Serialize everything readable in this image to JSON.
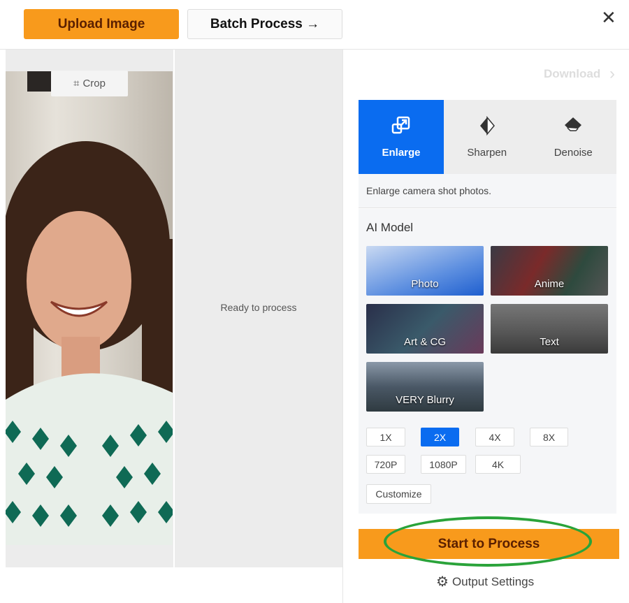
{
  "toolbar": {
    "upload_label": "Upload Image",
    "batch_label": "Batch Process →",
    "close_icon": "close-icon"
  },
  "preview": {
    "crop_label": "Crop",
    "status": "Ready to process"
  },
  "download_label": "Download",
  "tabs": [
    {
      "label": "Enlarge",
      "icon": "enlarge-icon",
      "active": true
    },
    {
      "label": "Sharpen",
      "icon": "sharpen-icon"
    },
    {
      "label": "Denoise",
      "icon": "eraser-icon"
    }
  ],
  "description": "Enlarge camera shot photos.",
  "ai_model": {
    "title": "AI Model",
    "models": [
      {
        "label": "Photo"
      },
      {
        "label": "Anime"
      },
      {
        "label": "Art & CG"
      },
      {
        "label": "Text"
      },
      {
        "label": "VERY Blurry"
      }
    ]
  },
  "scales": [
    {
      "label": "1X"
    },
    {
      "label": "2X",
      "active": true
    },
    {
      "label": "4X"
    },
    {
      "label": "8X"
    },
    {
      "label": "720P"
    },
    {
      "label": "1080P"
    },
    {
      "label": "4K"
    },
    {
      "label": "Customize"
    }
  ],
  "start_label": "Start to Process",
  "output_settings_label": "Output Settings",
  "colors": {
    "accent_orange": "#f89a1c",
    "accent_blue": "#0a6cf0",
    "highlight_green": "#2aa33a"
  }
}
